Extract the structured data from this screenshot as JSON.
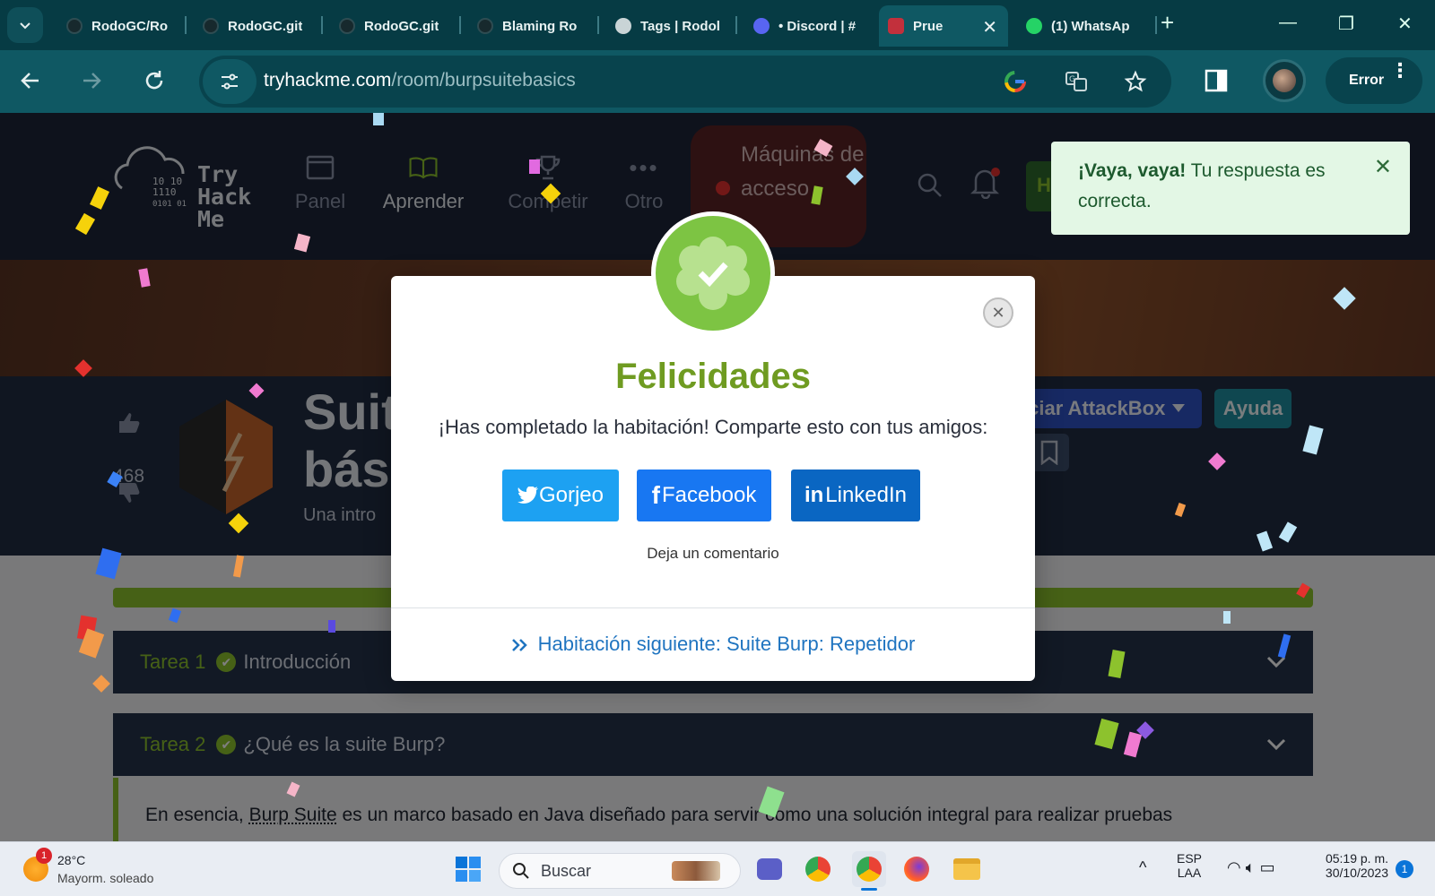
{
  "browser": {
    "tabs": [
      {
        "label": "RodoGC/Ro",
        "favicon": "github-icon"
      },
      {
        "label": "RodoGC.git",
        "favicon": "github-icon"
      },
      {
        "label": "RodoGC.git",
        "favicon": "github-icon"
      },
      {
        "label": "Blaming Ro",
        "favicon": "github-icon"
      },
      {
        "label": "Tags | Rodol",
        "favicon": "globe-icon"
      },
      {
        "label": "• Discord | #",
        "favicon": "discord-icon"
      },
      {
        "label": "Prue",
        "favicon": "tryhackme-icon",
        "active": true
      },
      {
        "label": "(1) WhatsAp",
        "favicon": "whatsapp-icon"
      }
    ],
    "url_host": "tryhackme.com",
    "url_path": "/room/burpsuitebasics",
    "error_label": "Error"
  },
  "site_nav": {
    "logo": [
      "Try",
      "Hack",
      "Me"
    ],
    "items": [
      {
        "label": "Panel",
        "icon": "dashboard-icon"
      },
      {
        "label": "Aprender",
        "icon": "book-icon"
      },
      {
        "label": "Competir",
        "icon": "trophy-icon"
      },
      {
        "label": "Otro",
        "icon": "more-icon"
      }
    ],
    "machine_label": "Máquinas de acceso",
    "nav_button_label": "H"
  },
  "room": {
    "title_line1": "Suit",
    "title_line2": "bási",
    "subtitle": "Una intro",
    "likes": "468",
    "attackbox_label": "iciar AttackBox",
    "help_label": "Ayuda"
  },
  "tasks": [
    {
      "number": "Tarea 1",
      "title": "Introducción"
    },
    {
      "number": "Tarea 2",
      "title": "¿Qué es la suite Burp?"
    }
  ],
  "task_body": {
    "before": "En esencia, ",
    "link": "Burp Suite",
    "after": " es un marco basado en Java diseñado para servir como una solución integral para realizar pruebas"
  },
  "toast": {
    "bold": "¡Vaya, vaya!",
    "text": " Tu respuesta es correcta."
  },
  "modal": {
    "title": "Felicidades",
    "subtitle": "¡Has completado la habitación! Comparte esto con tus amigos:",
    "share_twitter": "Gorjeo",
    "share_facebook": "Facebook",
    "share_linkedin": "LinkedIn",
    "comment": "Deja un comentario",
    "next_room": "Habitación siguiente: Suite Burp: Repetidor"
  },
  "taskbar": {
    "weather_temp": "28°C",
    "weather_desc": "Mayorm. soleado",
    "weather_badge": "1",
    "search_placeholder": "Buscar",
    "lang_top": "ESP",
    "lang_bottom": "LAA",
    "time": "05:19 p. m.",
    "date": "30/10/2023",
    "notification_count": "1"
  },
  "colors": {
    "browser_frame": "#063b44",
    "toolbar": "#0f5863",
    "success_green": "#7dc443",
    "link_blue": "#1f74c0",
    "twitter": "#1da1f2",
    "facebook": "#1877f2",
    "linkedin": "#0a66c2",
    "toast_bg": "#e3f7e5"
  }
}
